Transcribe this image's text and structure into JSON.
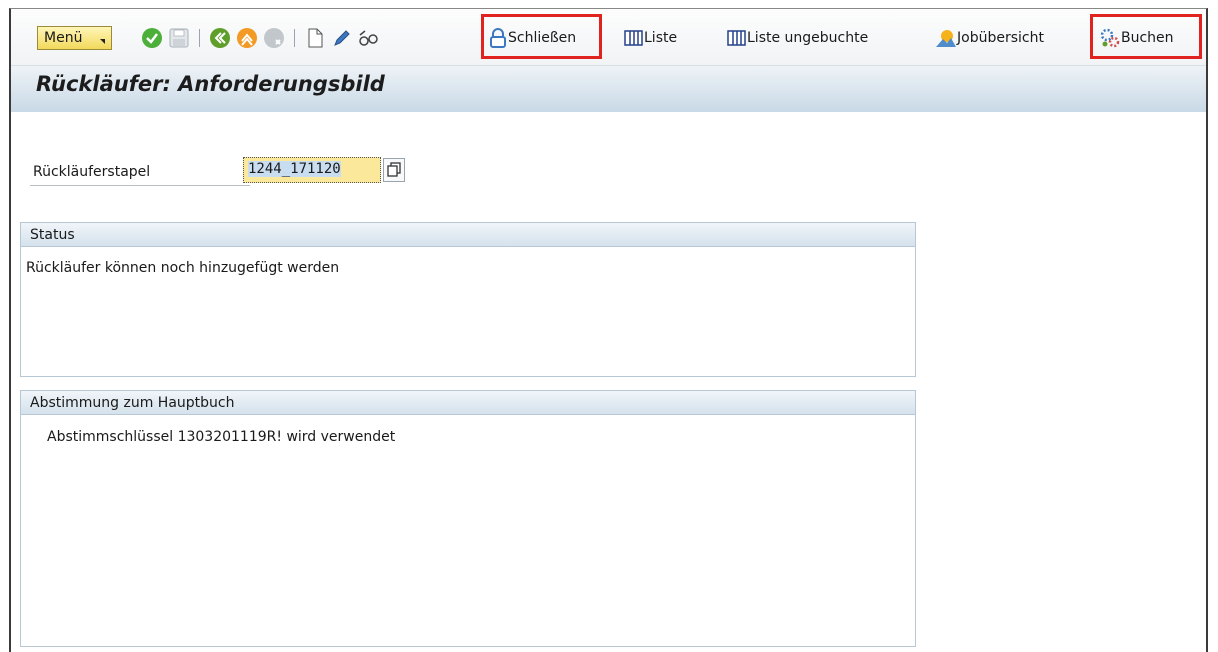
{
  "toolbar": {
    "menu_label": "Menü",
    "close_label": "Schließen",
    "list_label": "Liste",
    "list_unposted_label": "Liste ungebuchte",
    "job_overview_label": "Jobübersicht",
    "post_label": "Buchen",
    "icons": [
      "check-icon",
      "save-icon",
      "back-icon",
      "exit-icon",
      "cancel-icon",
      "new-document-icon",
      "edit-icon",
      "display-icon",
      "lock-icon",
      "list-icon",
      "job-overview-icon",
      "gears-icon"
    ]
  },
  "header": {
    "title": "Rückläufer: Anforderungsbild"
  },
  "form": {
    "field_label": "Rückläuferstapel",
    "field_value": "1244_171120"
  },
  "status_group": {
    "title": "Status",
    "text": "Rückläufer können noch hinzugefügt werden"
  },
  "ledger_group": {
    "title": "Abstimmung zum Hauptbuch",
    "text": "Abstimmschlüssel 1303201119R! wird verwendet"
  },
  "colors": {
    "highlight": "#e0231f",
    "title_bar": "#c9d9e6",
    "input_bg": "#fbe89a",
    "menu_button": "#f2d95c"
  }
}
